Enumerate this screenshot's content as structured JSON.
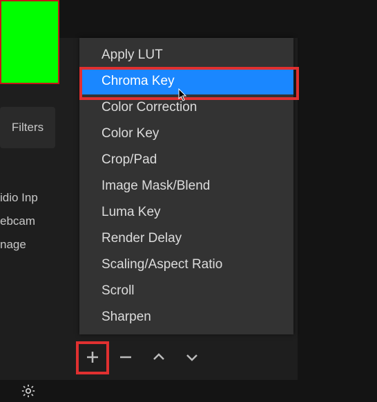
{
  "preview": {
    "label": "green-screen-preview"
  },
  "filters_button": {
    "label": "Filters"
  },
  "sources": {
    "items": [
      {
        "label": "idio Inp"
      },
      {
        "label": "ebcam"
      },
      {
        "label": "nage"
      }
    ]
  },
  "menu": {
    "items": [
      {
        "label": "Apply LUT",
        "selected": false
      },
      {
        "label": "Chroma Key",
        "selected": true
      },
      {
        "label": "Color Correction",
        "selected": false
      },
      {
        "label": "Color Key",
        "selected": false
      },
      {
        "label": "Crop/Pad",
        "selected": false
      },
      {
        "label": "Image Mask/Blend",
        "selected": false
      },
      {
        "label": "Luma Key",
        "selected": false
      },
      {
        "label": "Render Delay",
        "selected": false
      },
      {
        "label": "Scaling/Aspect Ratio",
        "selected": false
      },
      {
        "label": "Scroll",
        "selected": false
      },
      {
        "label": "Sharpen",
        "selected": false
      }
    ]
  },
  "toolbar": {
    "plus_tooltip": "Add filter",
    "minus_tooltip": "Remove filter"
  }
}
